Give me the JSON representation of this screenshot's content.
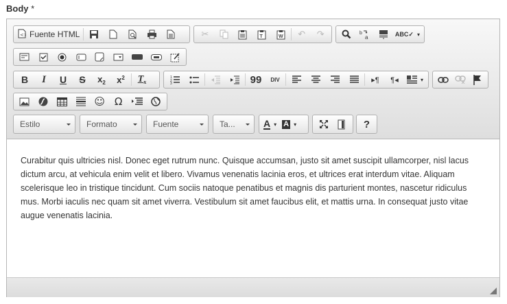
{
  "field": {
    "label": "Body",
    "required_mark": "*"
  },
  "toolbar": {
    "source_label": "Fuente HTML",
    "blockquote_label": "99",
    "div_label": "DIV",
    "combos": {
      "styles": "Estilo",
      "format": "Formato",
      "font": "Fuente",
      "size": "Ta..."
    },
    "text_color_label": "A",
    "bg_color_label": "A",
    "help_label": "?"
  },
  "content": {
    "text": "Curabitur quis ultricies nisl. Donec eget rutrum nunc. Quisque accumsan, justo sit amet suscipit ullamcorper, nisl lacus dictum arcu, at vehicula enim velit et libero. Vivamus venenatis lacinia eros, et ultrices erat interdum vitae. Aliquam scelerisque leo in tristique tincidunt. Cum sociis natoque penatibus et magnis dis parturient montes, nascetur ridiculus mus. Morbi iaculis nec quam sit amet viverra. Vestibulum sit amet faucibus elit, et mattis urna. In consequat justo vitae augue venenatis lacinia."
  },
  "icons": [
    "source-icon",
    "save-icon",
    "new-page-icon",
    "preview-icon",
    "print-icon",
    "templates-icon",
    "cut-icon",
    "copy-icon",
    "paste-icon",
    "paste-text-icon",
    "paste-word-icon",
    "undo-icon",
    "redo-icon",
    "find-icon",
    "replace-icon",
    "select-all-icon",
    "spellcheck-icon",
    "form-icon",
    "checkbox-icon",
    "radio-icon",
    "textfield-icon",
    "textarea-icon",
    "select-icon",
    "button-icon",
    "image-button-icon",
    "hidden-field-icon",
    "bold-icon",
    "italic-icon",
    "underline-icon",
    "strike-icon",
    "subscript-icon",
    "superscript-icon",
    "remove-format-icon",
    "numbered-list-icon",
    "bulleted-list-icon",
    "outdent-icon",
    "indent-icon",
    "blockquote-icon",
    "div-icon",
    "align-left-icon",
    "align-center-icon",
    "align-right-icon",
    "justify-icon",
    "ltr-icon",
    "rtl-icon",
    "language-icon",
    "link-icon",
    "unlink-icon",
    "anchor-icon",
    "image-icon",
    "flash-icon",
    "table-icon",
    "horizontal-rule-icon",
    "smiley-icon",
    "special-char-icon",
    "page-break-icon",
    "iframe-icon",
    "maximize-icon",
    "show-blocks-icon",
    "help-icon"
  ]
}
